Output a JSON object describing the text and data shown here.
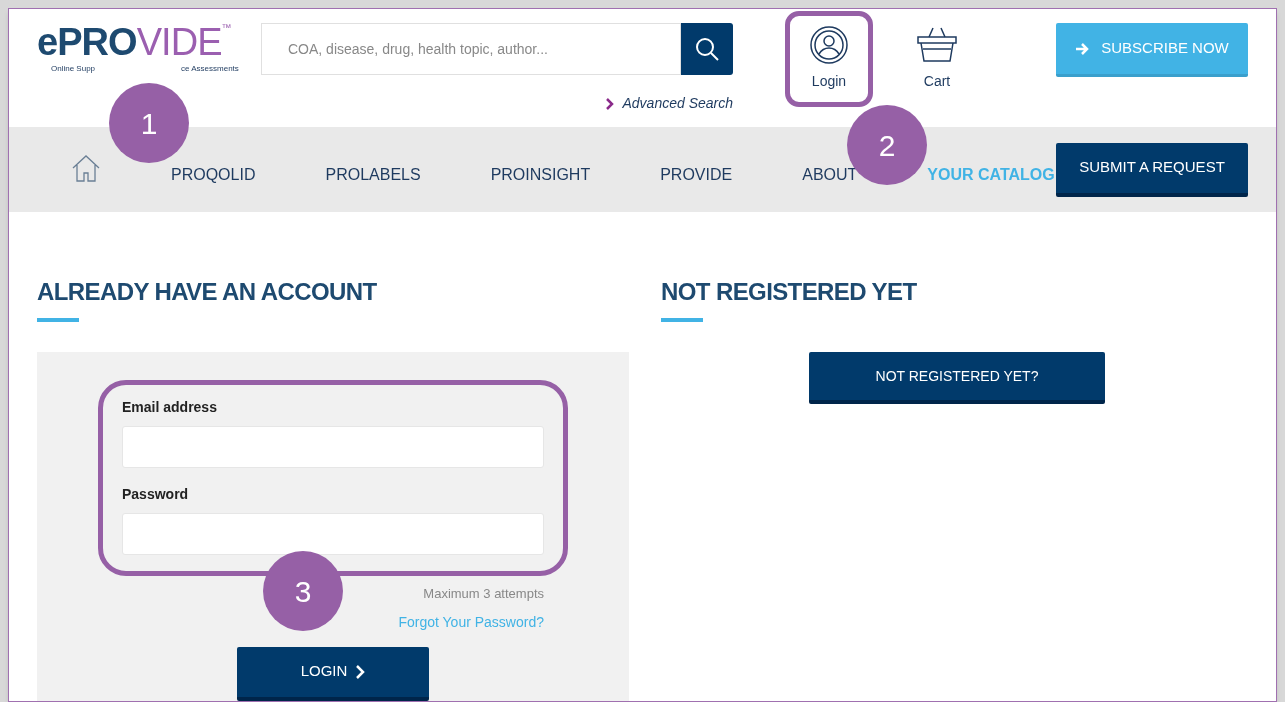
{
  "logo": {
    "brand_dark": "ePRO",
    "brand_light": "VIDE",
    "trademark": "™",
    "tagline_left": "Online Supp",
    "tagline_right": "ce Assessments"
  },
  "search": {
    "placeholder": "COA, disease, drug, health topic, author...",
    "advanced_link": "Advanced Search"
  },
  "header_actions": [
    {
      "label": "Login",
      "kind": "user",
      "framed": true
    },
    {
      "label": "Cart",
      "kind": "cart",
      "framed": false
    }
  ],
  "subscribe_button": "SUBSCRIBE NOW",
  "nav": {
    "items": [
      {
        "label": "PROQOLID",
        "highlighted": false
      },
      {
        "label": "PROLABELS",
        "highlighted": false
      },
      {
        "label": "PROINSIGHT",
        "highlighted": false
      },
      {
        "label": "PROVIDE",
        "highlighted": false
      },
      {
        "label": "ABOUT",
        "highlighted": false
      },
      {
        "label": "YOUR CATALOG",
        "highlighted": true
      }
    ],
    "request_button": "SUBMIT A REQUEST"
  },
  "login_section": {
    "heading": "ALREADY HAVE AN ACCOUNT",
    "fields": [
      {
        "label": "Email address"
      },
      {
        "label": "Password"
      }
    ],
    "attempts_note": "Maximum 3 attempts",
    "forgot_link": "Forgot Your Password?",
    "login_button": "LOGIN"
  },
  "register_section": {
    "heading": "NOT REGISTERED YET",
    "button": "NOT REGISTERED YET?"
  },
  "callouts": [
    "1",
    "2",
    "3"
  ]
}
